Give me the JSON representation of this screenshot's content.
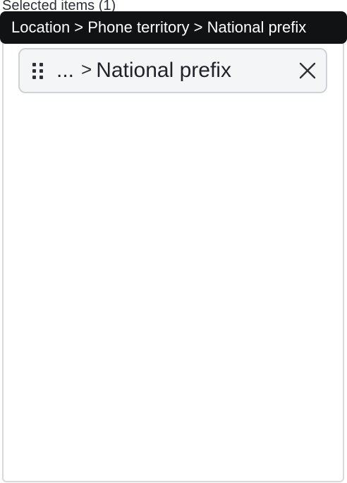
{
  "selected": {
    "label": "Selected items (1)",
    "items": [
      {
        "ellipsis": "...",
        "separator": ">",
        "name": "National prefix",
        "full_path": "Location > Phone territory > National prefix",
        "remove_icon": "close-icon",
        "drag_icon": "drag-handle-icon"
      }
    ]
  }
}
